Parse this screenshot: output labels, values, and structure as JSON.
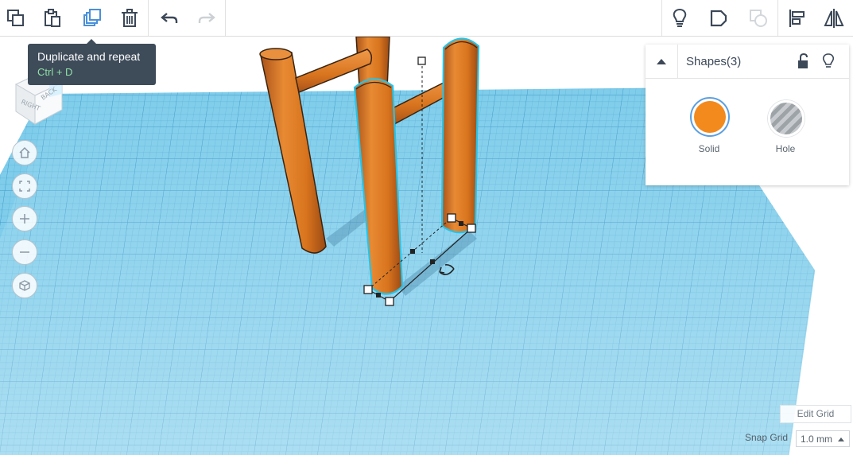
{
  "toolbar": {
    "tooltip": {
      "title": "Duplicate and repeat",
      "shortcut": "Ctrl + D"
    }
  },
  "viewcube": {
    "right_label": "RIGHT",
    "back_label": "BACK"
  },
  "inspector": {
    "title": "Shapes(3)",
    "solid_label": "Solid",
    "hole_label": "Hole",
    "solid_color": "#f28a1d"
  },
  "grid": {
    "edit_label": "Edit Grid",
    "snap_label": "Snap Grid",
    "snap_value": "1.0 mm"
  },
  "colors": {
    "accent": "#4a90d9",
    "workplane": "#7ccbea",
    "shape_orange": "#e07a22",
    "selection_outline": "#27c3e8"
  }
}
